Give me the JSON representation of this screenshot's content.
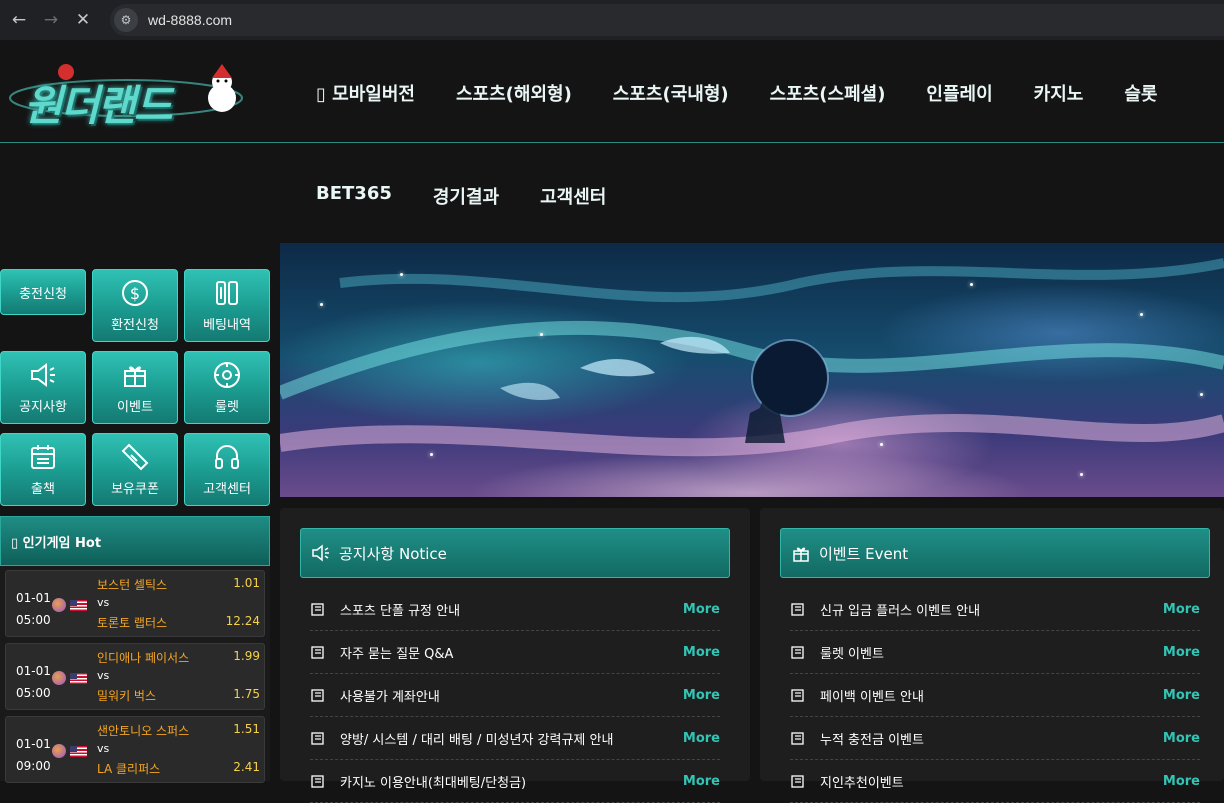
{
  "browser": {
    "url": "wd-8888.com"
  },
  "header": {
    "logo_text": "원더랜드",
    "main_nav": [
      "▯ 모바일버전",
      "스포츠(해외형)",
      "스포츠(국내형)",
      "스포츠(스페셜)",
      "인플레이",
      "카지노",
      "슬롯"
    ],
    "sub_nav": [
      "BET365",
      "경기결과",
      "고객센터"
    ]
  },
  "sidebar": {
    "quick_buttons": [
      "충전신청",
      "환전신청",
      "베팅내역",
      "공지사항",
      "이벤트",
      "룰렛",
      "출책",
      "보유쿠폰",
      "고객센터"
    ],
    "hot_title": "▯ 인기게임 Hot",
    "games": [
      {
        "date": "01-01",
        "time": "05:00",
        "home": "보스턴 셀틱스",
        "vs": "vs",
        "away": "토론토 랩터스",
        "odd_home": "1.01",
        "odd_away": "12.24"
      },
      {
        "date": "01-01",
        "time": "05:00",
        "home": "인디애나 페이서스",
        "vs": "vs",
        "away": "밀워키 벅스",
        "odd_home": "1.99",
        "odd_away": "1.75"
      },
      {
        "date": "01-01",
        "time": "09:00",
        "home": "샌안토니오 스퍼스",
        "vs": "vs",
        "away": "LA 클리퍼스",
        "odd_home": "1.51",
        "odd_away": "2.41"
      }
    ]
  },
  "notice": {
    "title": "공지사항 Notice",
    "more_label": "More",
    "items": [
      "스포츠 단폴 규정 안내",
      "자주 묻는 질문 Q&A",
      "사용불가 계좌안내",
      "양방/ 시스템 / 대리 배팅 / 미성년자 강력규제 안내",
      "카지노 이용안내(최대베팅/단청금)"
    ]
  },
  "event": {
    "title": "이벤트 Event",
    "more_label": "More",
    "items": [
      "신규 입금 플러스 이벤트 안내",
      "룰렛 이벤트",
      "페이백 이벤트 안내",
      "누적 충전금 이벤트",
      "지인추천이벤트"
    ]
  },
  "colors": {
    "accent": "#1f9d92",
    "more": "#33c4b6",
    "odds": "#f5d14a",
    "team": "#f5a623"
  }
}
